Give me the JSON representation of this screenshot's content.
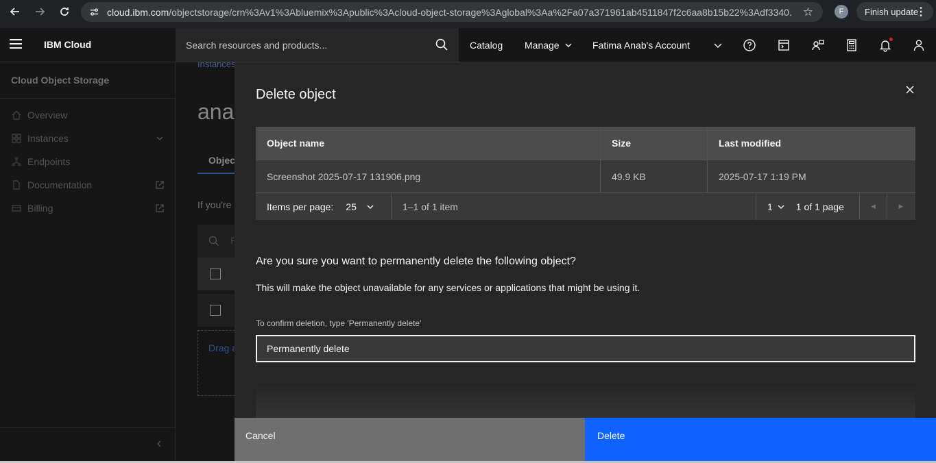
{
  "browser": {
    "url_host": "cloud.ibm.com",
    "url_path": "/objectstorage/crn%3Av1%3Abluemix%3Apublic%3Acloud-object-storage%3Aglobal%3Aa%2Fa07a371961ab4511847f2c6aa8b15b22%3Adf3340...",
    "profile_initial": "F",
    "finish_update_label": "Finish update"
  },
  "header": {
    "brand": "IBM Cloud",
    "search_placeholder": "Search resources and products...",
    "catalog": "Catalog",
    "manage": "Manage",
    "account": "Fatima Anab's Account"
  },
  "sidenav": {
    "title": "Cloud Object Storage",
    "items": [
      {
        "label": "Overview"
      },
      {
        "label": "Instances"
      },
      {
        "label": "Endpoints"
      },
      {
        "label": "Documentation"
      },
      {
        "label": "Billing"
      }
    ]
  },
  "background_page": {
    "breadcrumb": "Instances",
    "title": "ana",
    "tab": "Objec",
    "intro": "If you're",
    "search_partial": "F",
    "drop_text": "Drag a"
  },
  "modal": {
    "title": "Delete object",
    "table": {
      "headers": [
        "Object name",
        "Size",
        "Last modified"
      ],
      "rows": [
        [
          "Screenshot 2025-07-17 131906.png",
          "49.9 KB",
          "2025-07-17 1:19 PM"
        ]
      ]
    },
    "pagination": {
      "items_per_page_label": "Items per page:",
      "items_per_page_value": "25",
      "range_text": "1–1 of 1 item",
      "current_page": "1",
      "page_text": "1 of 1 page"
    },
    "question": "Are you sure you want to permanently delete the following object?",
    "warning": "This will make the object unavailable for any services or applications that might be using it.",
    "confirm_label": "To confirm deletion, type 'Permanently delete'",
    "confirm_value": "Permanently delete",
    "cancel_label": "Cancel",
    "delete_label": "Delete"
  },
  "colors": {
    "primary_button": "#0f62fe",
    "secondary_button": "#6f6f6f",
    "background": "#161616",
    "modal_background": "#262626"
  }
}
